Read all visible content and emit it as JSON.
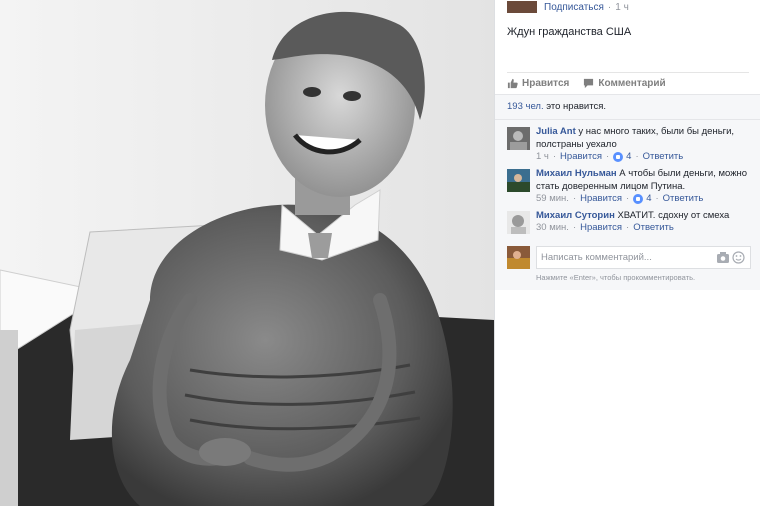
{
  "post": {
    "subscribe_label": "Подписаться",
    "separator": "·",
    "time": "1 ч",
    "text": "Ждун гражданства США"
  },
  "actions": {
    "like_label": "Нравится",
    "comment_label": "Комментарий"
  },
  "likes": {
    "count": "193 чел.",
    "suffix": "это нравится."
  },
  "comments": [
    {
      "author": "Julia Ant",
      "text": "у нас много таких, были бы деньги, полстраны уехало",
      "time": "1 ч",
      "like_label": "Нравится",
      "likes": "4",
      "reply_label": "Ответить"
    },
    {
      "author": "Михаил Нульман",
      "text": "А чтобы были деньги, можно стать доверенным лицом Путина.",
      "time": "59 мин.",
      "like_label": "Нравится",
      "likes": "4",
      "reply_label": "Ответить"
    },
    {
      "author": "Михаил Суторин",
      "text": "ХВАТИТ. сдохну от смеха",
      "time": "30 мин.",
      "like_label": "Нравится",
      "reply_label": "Ответить"
    }
  ],
  "compose": {
    "placeholder": "Написать комментарий...",
    "hint": "Нажмите «Enter», чтобы прокомментировать.",
    "camera_icon": "camera-icon",
    "emoji_icon": "smiley-icon"
  },
  "colors": {
    "link": "#365899",
    "muted": "#90949c",
    "like_blue": "#5890ff"
  }
}
